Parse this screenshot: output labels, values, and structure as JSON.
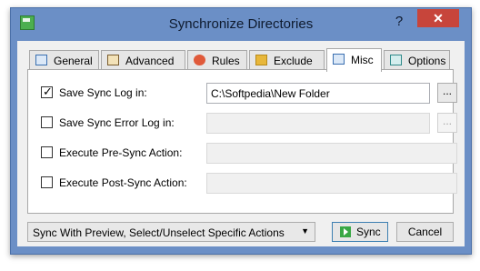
{
  "window": {
    "title": "Synchronize Directories",
    "help_label": "?",
    "close_label": "✕"
  },
  "tabs": [
    {
      "label": "General",
      "icon": "general-icon"
    },
    {
      "label": "Advanced",
      "icon": "advanced-icon"
    },
    {
      "label": "Rules",
      "icon": "rules-icon"
    },
    {
      "label": "Exclude",
      "icon": "exclude-icon"
    },
    {
      "label": "Misc",
      "icon": "misc-icon",
      "active": true
    },
    {
      "label": "Options",
      "icon": "options-icon"
    }
  ],
  "misc": {
    "save_sync_log": {
      "label": "Save Sync Log in:",
      "checked": true,
      "value": "C:\\Softpedia\\New Folder",
      "browse": "..."
    },
    "save_sync_error_log": {
      "label": "Save Sync Error Log in:",
      "checked": false,
      "value": "",
      "browse": "..."
    },
    "pre_sync_action": {
      "label": "Execute Pre-Sync Action:",
      "checked": false,
      "value": ""
    },
    "post_sync_action": {
      "label": "Execute Post-Sync Action:",
      "checked": false,
      "value": ""
    }
  },
  "footer": {
    "mode_selected": "Sync With Preview, Select/Unselect Specific Actions",
    "sync_label": "Sync",
    "cancel_label": "Cancel"
  },
  "colors": {
    "title_bar": "#6b8fc6",
    "close_button": "#c7453b",
    "sync_icon": "#39a845"
  }
}
